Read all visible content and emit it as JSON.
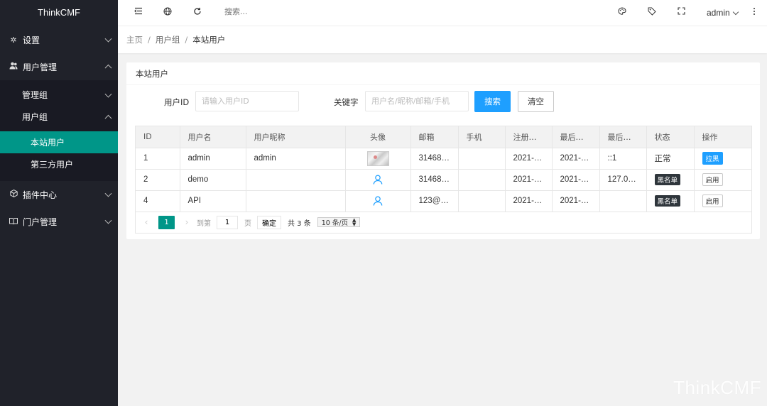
{
  "app": {
    "logo": "ThinkCMF"
  },
  "sidebar": {
    "items": [
      {
        "label": "设置",
        "icon": "gear-icon",
        "state": "collapsed"
      },
      {
        "label": "用户管理",
        "icon": "users-icon",
        "state": "expanded",
        "children": [
          {
            "label": "管理组",
            "state": "collapsed"
          },
          {
            "label": "用户组",
            "state": "expanded",
            "children": [
              {
                "label": "本站用户",
                "active": true
              },
              {
                "label": "第三方用户",
                "active": false
              }
            ]
          }
        ]
      },
      {
        "label": "插件中心",
        "icon": "cube-icon",
        "state": "collapsed"
      },
      {
        "label": "门户管理",
        "icon": "book-icon",
        "state": "collapsed"
      }
    ]
  },
  "header": {
    "search_placeholder": "搜索...",
    "user": "admin",
    "icons": [
      "menu-fold-icon",
      "globe-icon",
      "refresh-icon",
      "theme-icon",
      "tag-icon",
      "fullscreen-icon",
      "more-icon"
    ]
  },
  "breadcrumb": [
    "主页",
    "用户组",
    "本站用户"
  ],
  "card": {
    "title": "本站用户",
    "form": {
      "userid_label": "用户ID",
      "userid_placeholder": "请输入用户ID",
      "keyword_label": "关键字",
      "keyword_placeholder": "用户名/昵称/邮箱/手机",
      "search_button": "搜索",
      "clear_button": "清空"
    },
    "table": {
      "headers": [
        "ID",
        "用户名",
        "用户昵称",
        "头像",
        "邮箱",
        "手机",
        "注册…",
        "最后…",
        "最后…",
        "状态",
        "操作"
      ],
      "rows": [
        {
          "id": "1",
          "username": "admin",
          "nickname": "admin",
          "avatar": "image",
          "email": "31468…",
          "phone": "",
          "registered": "2021-…",
          "last_login": "2021-…",
          "last_ip": "::1",
          "status": "正常",
          "status_type": "text",
          "action": "拉黑",
          "action_type": "primary"
        },
        {
          "id": "2",
          "username": "demo",
          "nickname": "",
          "avatar": "default",
          "email": "31468…",
          "phone": "",
          "registered": "2021-…",
          "last_login": "2021-…",
          "last_ip": "127.0.…",
          "status": "黑名单",
          "status_type": "badge",
          "action": "启用",
          "action_type": "plain"
        },
        {
          "id": "4",
          "username": "API",
          "nickname": "",
          "avatar": "default",
          "email": "123@…",
          "phone": "",
          "registered": "2021-…",
          "last_login": "2021-…",
          "last_ip": "",
          "status": "黑名单",
          "status_type": "badge",
          "action": "启用",
          "action_type": "plain"
        }
      ]
    },
    "pager": {
      "current": "1",
      "goto_label": "到第",
      "goto_value": "1",
      "page_label": "页",
      "confirm": "确定",
      "total": "共 3 条",
      "page_size": "10 条/页"
    }
  },
  "colors": {
    "sidebar": "#20222a",
    "active": "#009688",
    "primary": "#1e9fff"
  },
  "watermark": "ThinkCMF"
}
